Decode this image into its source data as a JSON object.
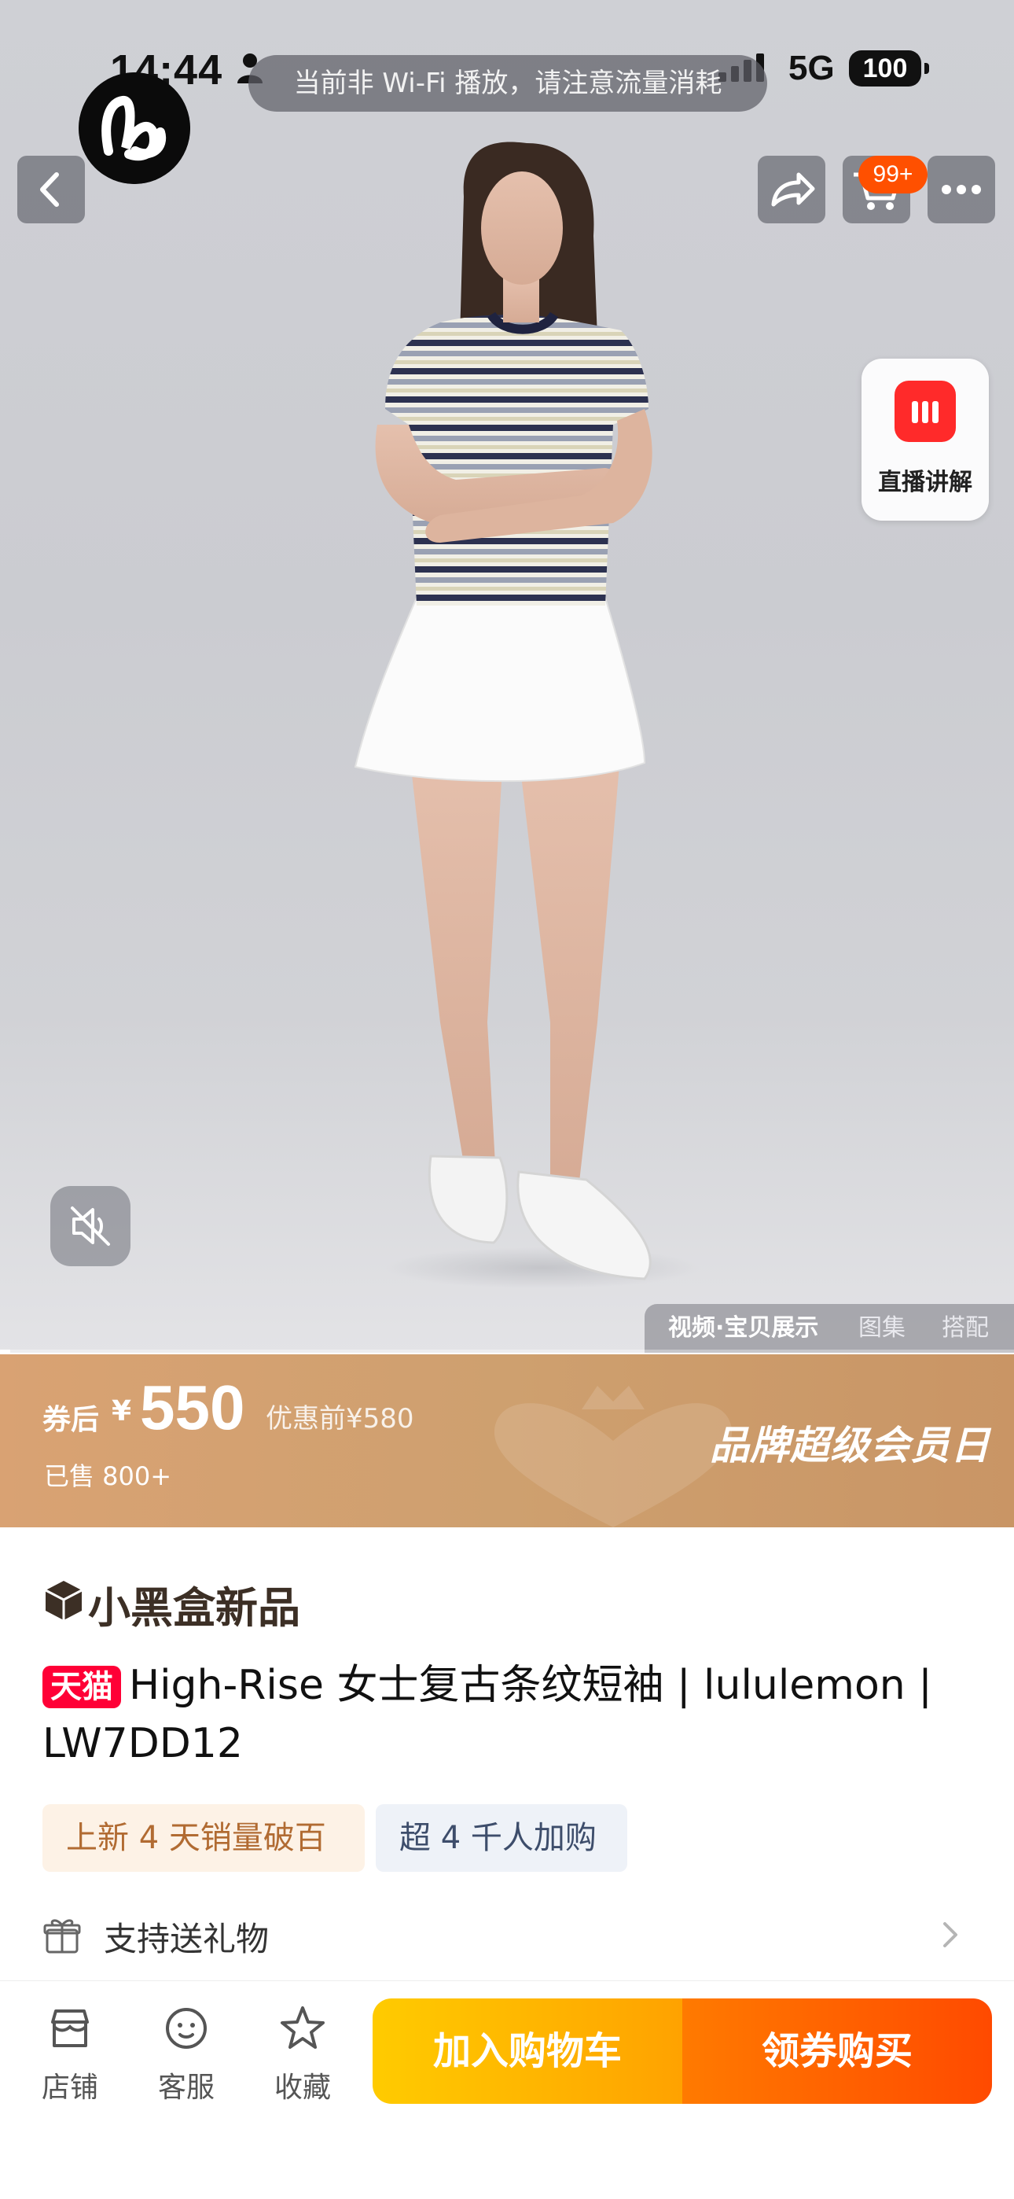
{
  "status_bar": {
    "time": "14:44",
    "network": "5G",
    "battery": "100"
  },
  "toast": {
    "text": "当前非 Wi-Fi 播放，请注意流量消耗"
  },
  "header": {
    "cart_badge": "99+"
  },
  "live": {
    "label": "直播讲解"
  },
  "media": {
    "tabs": [
      "视频·宝贝展示",
      "图集",
      "搭配"
    ],
    "active_tab": 0,
    "progress": 0.01
  },
  "price": {
    "coupon_label": "券后",
    "currency": "¥",
    "amount": "550",
    "original": "优惠前¥580",
    "sold": "已售 800+",
    "promo": "品牌超级会员日"
  },
  "product": {
    "collection": "小黑盒新品",
    "platform_badge": "天猫",
    "title": "High-Rise 女士复古条纹短袖 | lululemon | LW7DD12",
    "tags": [
      "上新 4 天销量破百",
      "超 4 千人加购"
    ],
    "gift": "支持送礼物"
  },
  "bottom_bar": {
    "shop": "店铺",
    "service": "客服",
    "favorite": "收藏",
    "add_to_cart": "加入购物车",
    "buy_now": "领券购买"
  },
  "colors": {
    "brand_orange": "#ff5000",
    "tmall_red": "#ff0036",
    "banner_gold": "#d9a273",
    "cta_yellow": "#ffb800"
  },
  "icons": [
    "back-arrow-icon",
    "share-icon",
    "cart-icon",
    "more-icon",
    "live-bars-icon",
    "mute-icon",
    "cube-icon",
    "gift-icon",
    "chevron-right-icon",
    "shop-icon",
    "service-icon",
    "star-icon"
  ]
}
